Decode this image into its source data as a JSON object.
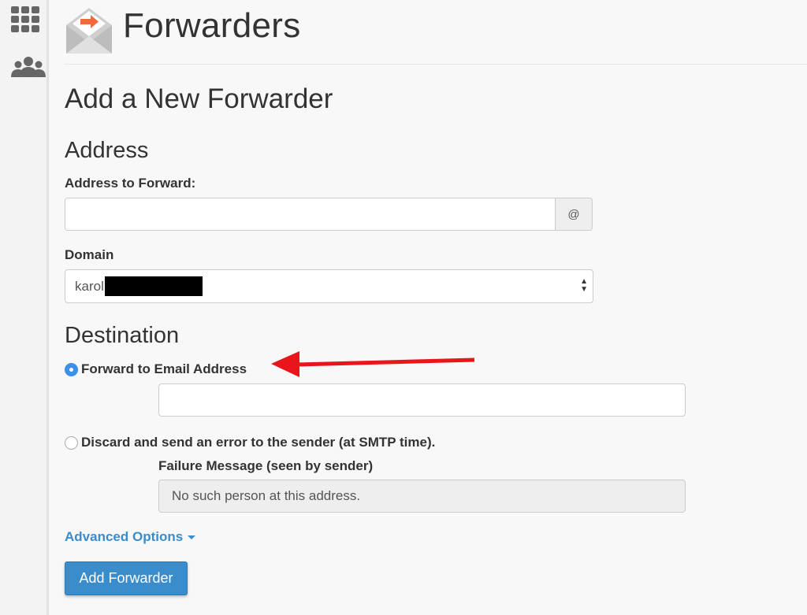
{
  "sidebar": {
    "icons": [
      "apps-grid-icon",
      "users-icon"
    ]
  },
  "header": {
    "title": "Forwarders",
    "logo_icon": "envelope-forward-icon"
  },
  "form": {
    "heading": "Add a New Forwarder",
    "address_section": {
      "heading": "Address",
      "address_label": "Address to Forward:",
      "address_value": "",
      "at_symbol": "@",
      "domain_label": "Domain",
      "domain_value_visible": "karol",
      "domain_redacted": true
    },
    "destination_section": {
      "heading": "Destination",
      "options": [
        {
          "label": "Forward to Email Address",
          "selected": true
        },
        {
          "label": "Discard and send an error to the sender (at SMTP time).",
          "selected": false
        }
      ],
      "forward_email_value": "",
      "failure_label": "Failure Message (seen by sender)",
      "failure_message": "No such person at this address."
    },
    "advanced_options_label": "Advanced Options",
    "submit_label": "Add Forwarder"
  },
  "annotation": {
    "arrow_color": "#e8161b"
  },
  "colors": {
    "primary": "#3a8ccb",
    "radio_selected": "#3d8fe8"
  }
}
